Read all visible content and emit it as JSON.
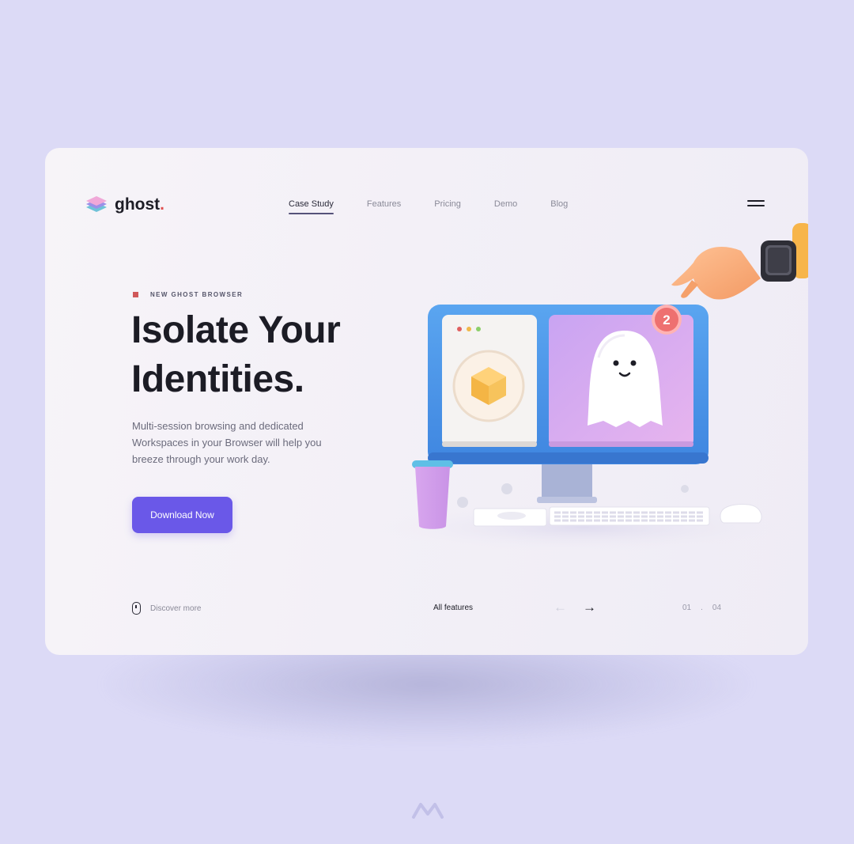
{
  "brand": {
    "name": "ghost",
    "dot": "."
  },
  "nav": {
    "items": [
      {
        "label": "Case Study",
        "active": true
      },
      {
        "label": "Features"
      },
      {
        "label": "Pricing"
      },
      {
        "label": "Demo"
      },
      {
        "label": "Blog"
      }
    ]
  },
  "hero": {
    "eyebrow": "NEW GHOST BROWSER",
    "title_line1": "Isolate Your",
    "title_line2": "Identities.",
    "description": "Multi-session browsing and dedicated Workspaces in your Browser will help you breeze through your work day.",
    "cta_label": "Download Now"
  },
  "illustration": {
    "badge_count": "2"
  },
  "footer": {
    "discover_label": "Discover more",
    "all_features_label": "All features",
    "prev_icon": "arrow-left-icon",
    "next_icon": "arrow-right-icon",
    "page_current": "01",
    "page_sep": ".",
    "page_total": "04"
  },
  "colors": {
    "background": "#dcdaf6",
    "card": "#f4f1f7",
    "accent": "#6a58e8",
    "brand_dot": "#e04f4f",
    "monitor": "#4f97ea",
    "ghost_panel": "#d5a6f0"
  }
}
